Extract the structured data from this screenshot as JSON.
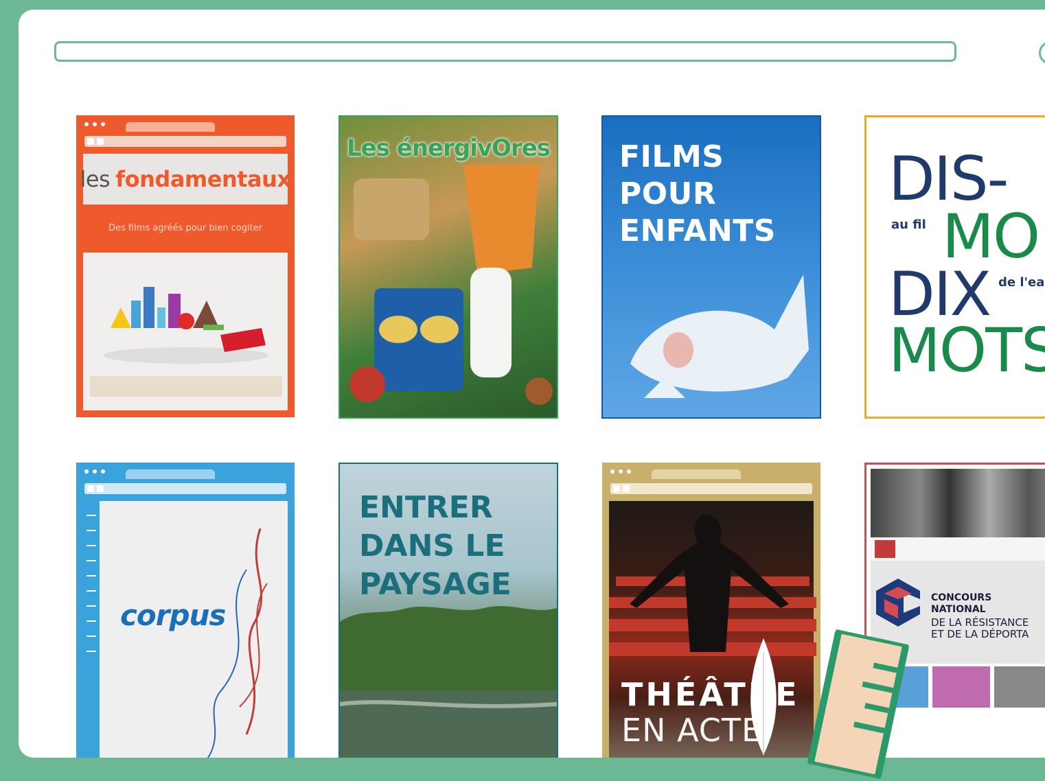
{
  "colors": {
    "background": "#6cb894",
    "window": "#ffffff",
    "accent": "#6cb894"
  },
  "tiles": [
    {
      "id": "fondamentaux",
      "prefix": "les",
      "title": "fondamentaux",
      "subtitle": "Des films agréés pour bien cogiter",
      "color": "#ef5a2c"
    },
    {
      "id": "energivores",
      "title": "Les énergivOres",
      "color": "#3aa35b"
    },
    {
      "id": "films-pour-enfants",
      "title_lines": [
        "FILMS",
        "POUR",
        "ENFANTS"
      ],
      "color": "#1a6ec0"
    },
    {
      "id": "dis-mots",
      "words": [
        "DIS-",
        "MO",
        "DIX",
        "MOTS"
      ],
      "small1": "au fil",
      "small2": "de l'eau",
      "color": "#f5a623"
    },
    {
      "id": "corpus",
      "title": "corpus",
      "color": "#3aa3dc"
    },
    {
      "id": "paysage",
      "title_lines": [
        "ENTRER",
        "DANS LE",
        "PAYSAGE"
      ],
      "color": "#1b6f7c"
    },
    {
      "id": "theatre",
      "line1": "THÉÂTRE",
      "line2": "EN ACTE",
      "color": "#c8b06a"
    },
    {
      "id": "concours",
      "title_lines": [
        "CONCOURS",
        "NATIONAL"
      ],
      "sub_lines": [
        "DE LA RÉSISTANCE",
        "ET DE LA DÉPORTA"
      ],
      "color": "#d24c52"
    }
  ]
}
